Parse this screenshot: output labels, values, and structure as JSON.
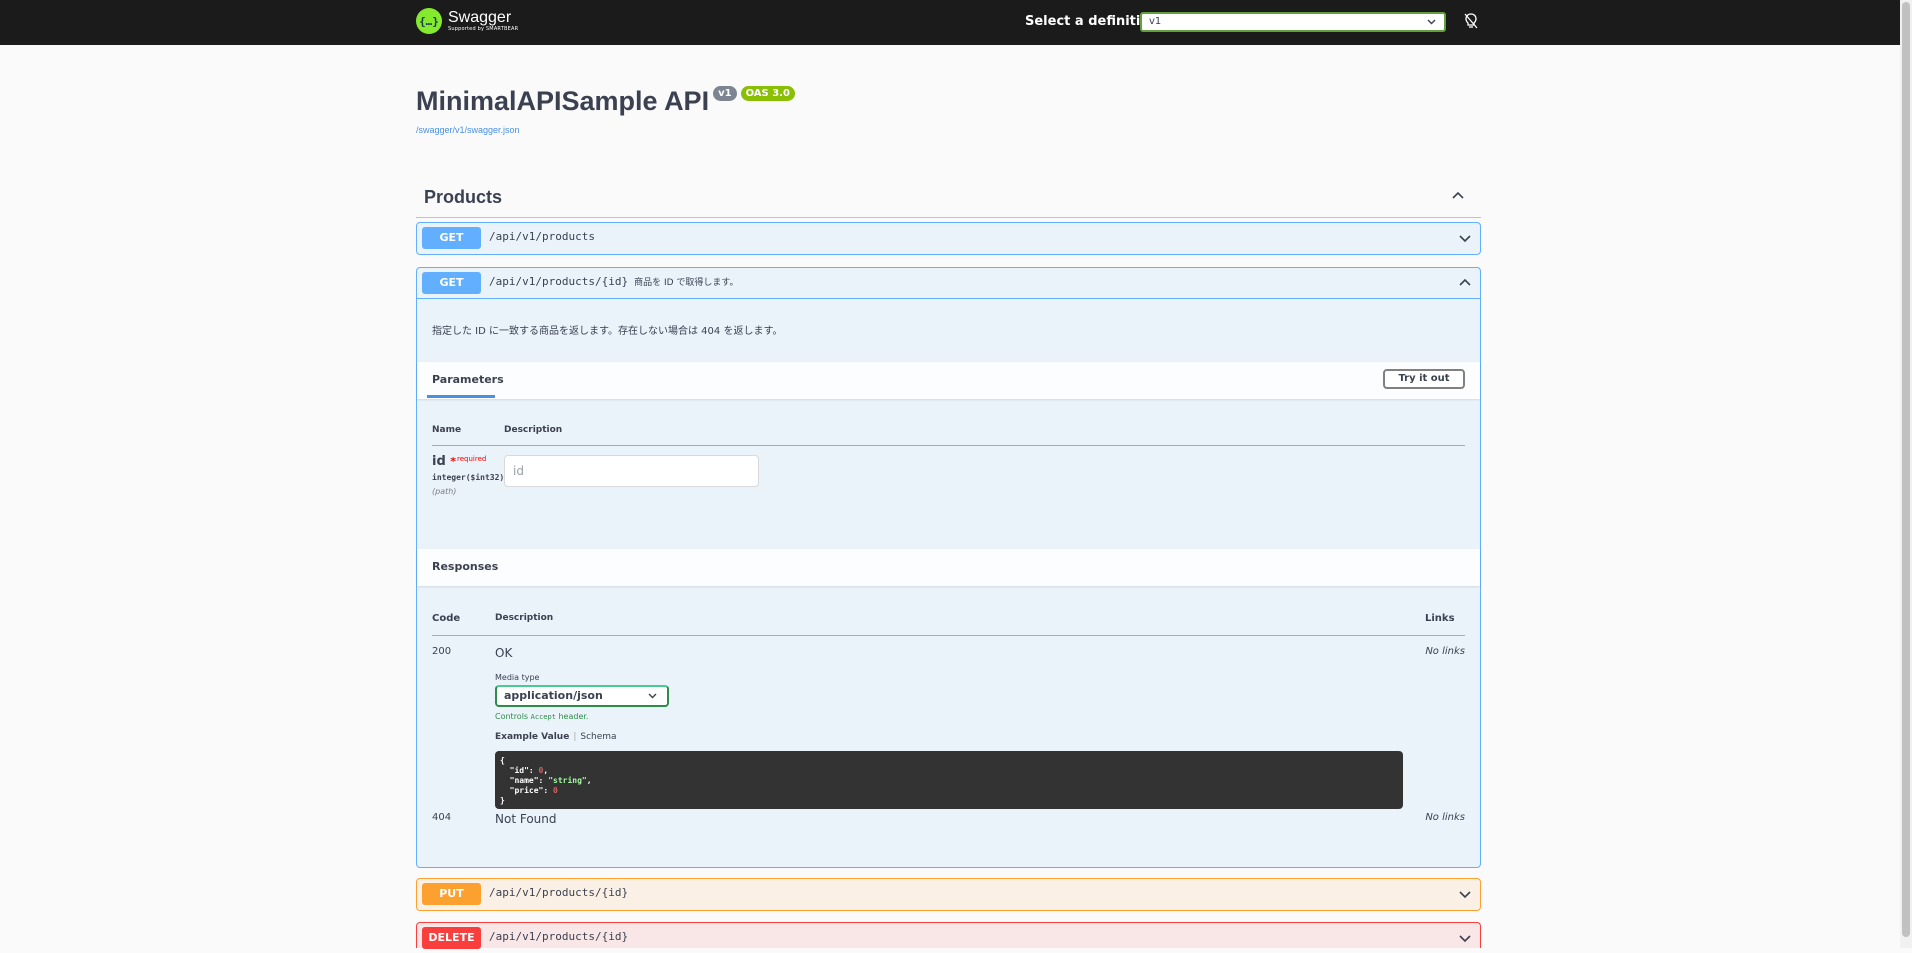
{
  "topbar": {
    "brand_name": "Swagger",
    "brand_sub": "Supported by SMARTBEAR",
    "definition_label": "Select a definition",
    "definition_value": "v1"
  },
  "info": {
    "title": "MinimalAPISample API",
    "version": "v1",
    "oas": "OAS 3.0",
    "spec_url": "/swagger/v1/swagger.json"
  },
  "tag": {
    "name": "Products"
  },
  "operations": [
    {
      "method": "GET",
      "path": "/api/v1/products",
      "summary": ""
    },
    {
      "method": "GET",
      "path": "/api/v1/products/{id}",
      "summary": "商品を ID で取得します。",
      "description": "指定した ID に一致する商品を返します。存在しない場合は 404 を返します。",
      "parameters_title": "Parameters",
      "try_label": "Try it out",
      "param_cols": {
        "name": "Name",
        "description": "Description"
      },
      "param": {
        "name": "id",
        "star": "*",
        "required": "required",
        "type": "integer($int32)",
        "in": "(path)",
        "placeholder": "id"
      },
      "responses_title": "Responses",
      "resp_cols": {
        "code": "Code",
        "description": "Description",
        "links": "Links"
      },
      "responses": [
        {
          "code": "200",
          "description": "OK",
          "links": "No links"
        },
        {
          "code": "404",
          "description": "Not Found",
          "links": "No links"
        }
      ],
      "media_type_label": "Media type",
      "media_type": "application/json",
      "controls_pre": "Controls",
      "controls_code": "Accept",
      "controls_post": "header.",
      "example_tab": "Example Value",
      "schema_tab": "Schema",
      "example": {
        "open": "{",
        "lines": [
          {
            "key": "\"id\"",
            "value": "0",
            "kind": "num",
            "comma": ","
          },
          {
            "key": "\"name\"",
            "value": "\"string\"",
            "kind": "str",
            "comma": ","
          },
          {
            "key": "\"price\"",
            "value": "0",
            "kind": "num",
            "comma": ""
          }
        ],
        "close": "}"
      }
    },
    {
      "method": "PUT",
      "path": "/api/v1/products/{id}",
      "summary": ""
    },
    {
      "method": "DELETE",
      "path": "/api/v1/products/{id}",
      "summary": ""
    }
  ],
  "colors": {
    "get": "#61affe",
    "put": "#fca130",
    "delete": "#f93e3e",
    "topbar": "#1b1b1b",
    "accent": "#85ea2d"
  }
}
